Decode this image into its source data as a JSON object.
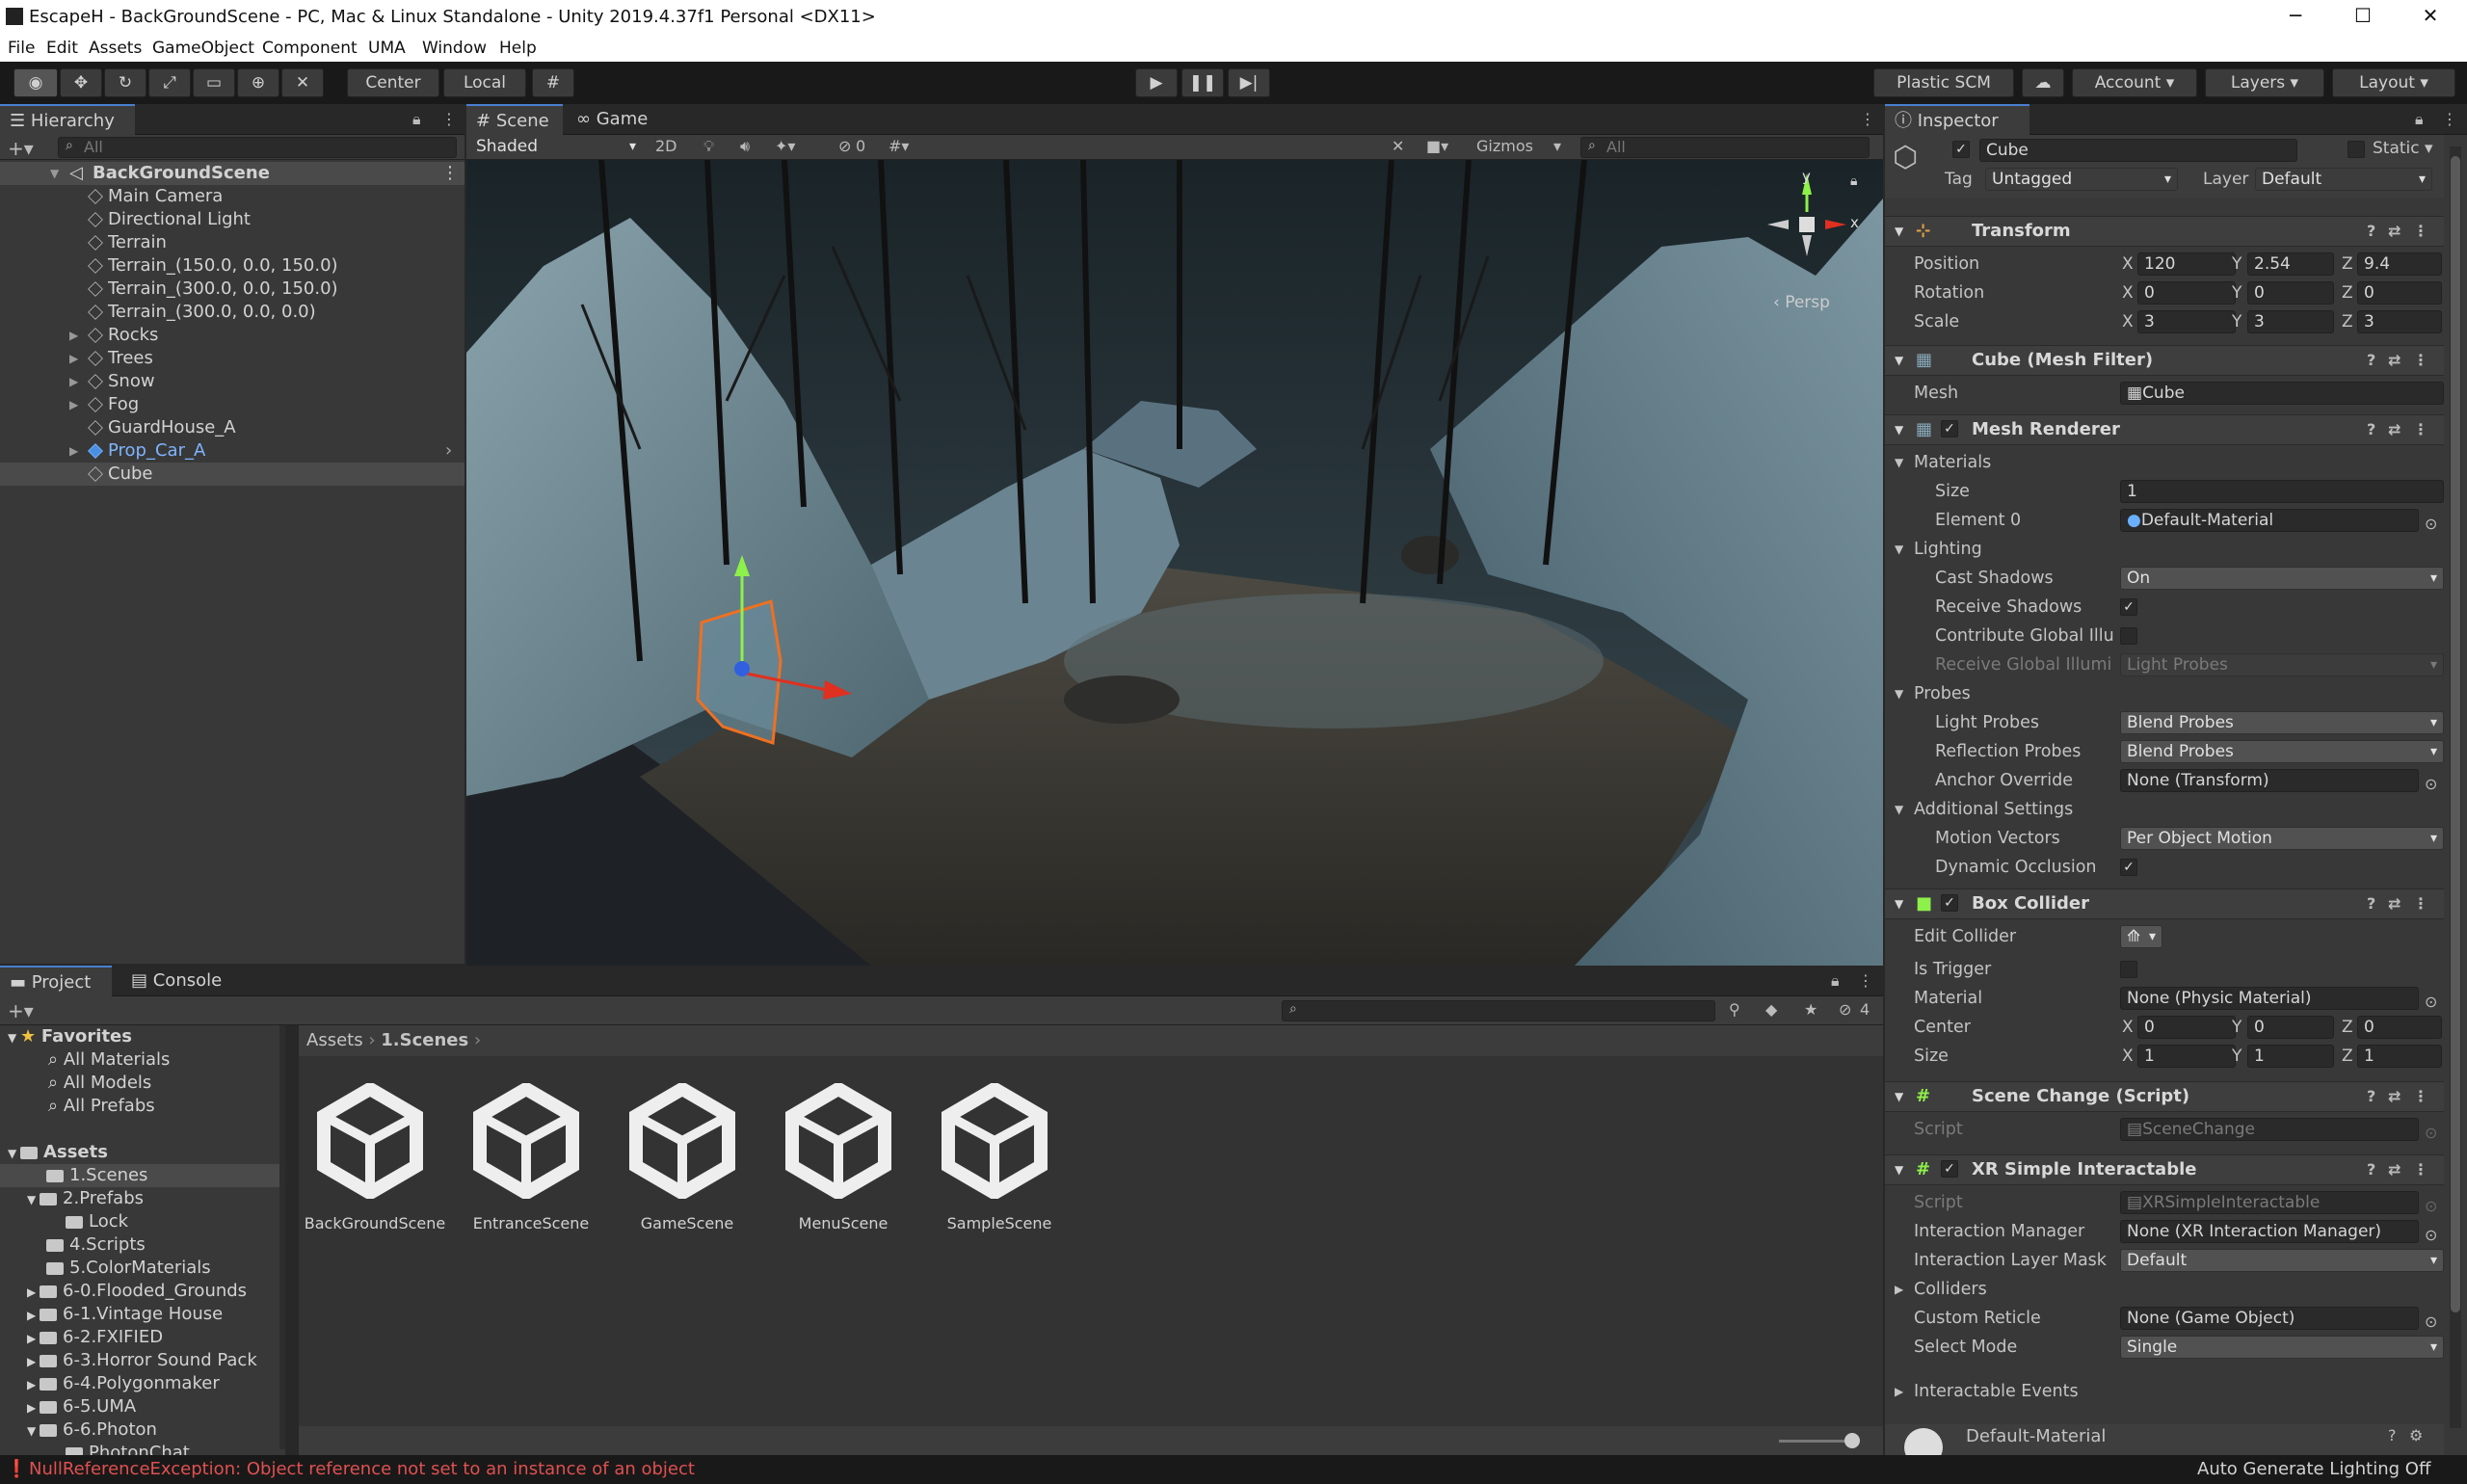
{
  "window": {
    "title": "EscapeH - BackGroundScene - PC, Mac & Linux Standalone - Unity 2019.4.37f1 Personal <DX11>",
    "min": "─",
    "max": "☐",
    "close": "✕"
  },
  "menu": [
    "File",
    "Edit",
    "Assets",
    "GameObject",
    "Component",
    "UMA",
    "Window",
    "Help"
  ],
  "toolbar": {
    "pivot": "Center",
    "space": "Local",
    "plastic": "Plastic SCM",
    "account": "Account",
    "layers": "Layers",
    "layout": "Layout"
  },
  "hierarchy": {
    "tab": "Hierarchy",
    "search": "All",
    "scene": "BackGroundScene",
    "items": [
      {
        "label": "Main Camera"
      },
      {
        "label": "Directional Light"
      },
      {
        "label": "Terrain"
      },
      {
        "label": "Terrain_(150.0, 0.0, 150.0)"
      },
      {
        "label": "Terrain_(300.0, 0.0, 150.0)"
      },
      {
        "label": "Terrain_(300.0, 0.0, 0.0)"
      },
      {
        "label": "Rocks"
      },
      {
        "label": "Trees"
      },
      {
        "label": "Snow"
      },
      {
        "label": "Fog"
      },
      {
        "label": "GuardHouse_A"
      },
      {
        "label": "Prop_Car_A"
      },
      {
        "label": "Cube"
      }
    ]
  },
  "scene": {
    "tab": "Scene",
    "game_tab": "Game",
    "shading": "Shaded",
    "mode2d": "2D",
    "hidden": "0",
    "gizmos": "Gizmos",
    "search": "All",
    "persp": "Persp",
    "axis_y": "y",
    "axis_x": "x"
  },
  "inspector": {
    "tab": "Inspector",
    "name": "Cube",
    "static": "Static",
    "tag_label": "Tag",
    "tag": "Untagged",
    "layer_label": "Layer",
    "layer": "Default",
    "transform": {
      "title": "Transform",
      "position": "Position",
      "rotation": "Rotation",
      "scale": "Scale",
      "pos": [
        "120",
        "2.54",
        "9.4"
      ],
      "rot": [
        "0",
        "0",
        "0"
      ],
      "scl": [
        "3",
        "3",
        "3"
      ]
    },
    "meshfilter": {
      "title": "Cube (Mesh Filter)",
      "mesh_label": "Mesh",
      "mesh": "Cube"
    },
    "renderer": {
      "title": "Mesh Renderer",
      "materials": "Materials",
      "size_label": "Size",
      "size": "1",
      "el0_label": "Element 0",
      "el0": "Default-Material",
      "lighting": "Lighting",
      "cast_label": "Cast Shadows",
      "cast": "On",
      "recv_label": "Receive Shadows",
      "contrib_label": "Contribute Global Illu",
      "recvgi_label": "Receive Global Illumi",
      "recvgi": "Light Probes",
      "probes": "Probes",
      "lp_label": "Light Probes",
      "lp": "Blend Probes",
      "rp_label": "Reflection Probes",
      "rp": "Blend Probes",
      "anchor_label": "Anchor Override",
      "anchor": "None (Transform)",
      "additional": "Additional Settings",
      "mv_label": "Motion Vectors",
      "mv": "Per Object Motion",
      "dyn_label": "Dynamic Occlusion"
    },
    "box": {
      "title": "Box Collider",
      "edit_label": "Edit Collider",
      "trigger_label": "Is Trigger",
      "mat_label": "Material",
      "mat": "None (Physic Material)",
      "center_label": "Center",
      "center": [
        "0",
        "0",
        "0"
      ],
      "size_label": "Size",
      "size": [
        "1",
        "1",
        "1"
      ]
    },
    "script": {
      "title": "Scene Change (Script)",
      "script_label": "Script",
      "script": "SceneChange"
    },
    "xr": {
      "title": "XR Simple Interactable",
      "script_label": "Script",
      "script": "XRSimpleInteractable",
      "im_label": "Interaction Manager",
      "im": "None (XR Interaction Manager)",
      "ilm_label": "Interaction Layer Mask",
      "ilm": "Default",
      "colliders": "Colliders",
      "reticle_label": "Custom Reticle",
      "reticle": "None (Game Object)",
      "select_label": "Select Mode",
      "select": "Single",
      "events": "Interactable Events"
    },
    "material_preview": "Default-Material"
  },
  "project": {
    "tab": "Project",
    "console_tab": "Console",
    "hidden": "4",
    "breadcrumb": [
      "Assets",
      "1.Scenes"
    ],
    "favorites": "Favorites",
    "fav_items": [
      "All Materials",
      "All Models",
      "All Prefabs"
    ],
    "assets": "Assets",
    "folders": [
      "1.Scenes",
      "2.Prefabs",
      "Lock",
      "4.Scripts",
      "5.ColorMaterials",
      "6-0.Flooded_Grounds",
      "6-1.Vintage House",
      "6-2.FXIFIED",
      "6-3.Horror Sound Pack",
      "6-4.Polygonmaker",
      "6-5.UMA",
      "6-6.Photon",
      "PhotonChat"
    ],
    "scenes": [
      "BackGroundScene",
      "EntranceScene",
      "GameScene",
      "MenuScene",
      "SampleScene"
    ]
  },
  "status": {
    "error": "NullReferenceException: Object reference not set to an instance of an object",
    "right": "Auto Generate Lighting Off"
  }
}
